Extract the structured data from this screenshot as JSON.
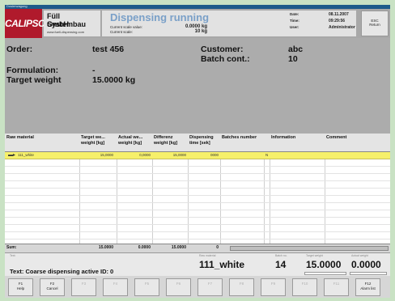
{
  "window": {
    "title_strip": "Dosierwagung"
  },
  "header": {
    "logo": "CALIPSO",
    "company_line1": "Füll Systembau",
    "company_line2": "GmbH",
    "company_url": "www.fuell-dispensing.com",
    "status_title": "Dispensing running",
    "scale_label1": "Current scale value:",
    "scale_value1": "0.0000 kg",
    "scale_label2": "Current scale:",
    "scale_value2": "10 kg",
    "date_label": "Date:",
    "date_value": "08.11.2007",
    "time_label": "Time:",
    "time_value": "09:29:56",
    "user_label": "User:",
    "user_value": "Administrator",
    "esc_line1": "ESC",
    "esc_line2": "Return"
  },
  "order": {
    "order_label": "Order:",
    "order_value": "test 456",
    "customer_label": "Customer:",
    "customer_value": "abc",
    "batch_label": "Batch cont.:",
    "batch_value": "10",
    "formulation_label": "Formulation:",
    "formulation_value": "-",
    "target_label": "Target weight",
    "target_value": "15.0000 kg"
  },
  "table": {
    "headers": {
      "raw_material": "Raw material",
      "target": "Target we... weight [kg]",
      "actual": "Actual we... weight [kg]",
      "difference": "Differenz weight [kg]",
      "dispensing": "Dispensing time [sek]",
      "batches": "Batches number",
      "information": "Information",
      "comment": "Comment"
    },
    "row": {
      "raw_material": "111_white",
      "target": "15,0000",
      "actual": "0,0000",
      "difference": "15,0000",
      "time": "0000",
      "flag": "N"
    },
    "sum": {
      "label": "Sum:",
      "target": "15.0000",
      "actual": "0.0000",
      "difference": "15.0000",
      "time": "0"
    }
  },
  "infobar": {
    "label_text": "Text:",
    "message": "Text: Coarse dispensing active ID: 0",
    "material": "111_white",
    "number": "14",
    "weight1": "15.0000",
    "weight2": "0.0000",
    "sub_material": "Raw material",
    "sub_number": "Batch no.",
    "sub_weight1": "Target weight",
    "sub_weight2": "Actual weight"
  },
  "fkeys": [
    {
      "key": "F1",
      "label": "Help"
    },
    {
      "key": "F2",
      "label": "Cancel"
    },
    {
      "key": "F3",
      "label": ""
    },
    {
      "key": "F4",
      "label": ""
    },
    {
      "key": "F5",
      "label": ""
    },
    {
      "key": "F6",
      "label": ""
    },
    {
      "key": "F7",
      "label": ""
    },
    {
      "key": "F8",
      "label": ""
    },
    {
      "key": "F9",
      "label": ""
    },
    {
      "key": "F10",
      "label": ""
    },
    {
      "key": "F11",
      "label": ""
    },
    {
      "key": "F12",
      "label": "Alarm list"
    }
  ],
  "colors": {
    "frame": "#c9e2c4",
    "logo": "#b01a2c",
    "status_title": "#7aa0c8",
    "selected_row": "#f6f06a"
  }
}
